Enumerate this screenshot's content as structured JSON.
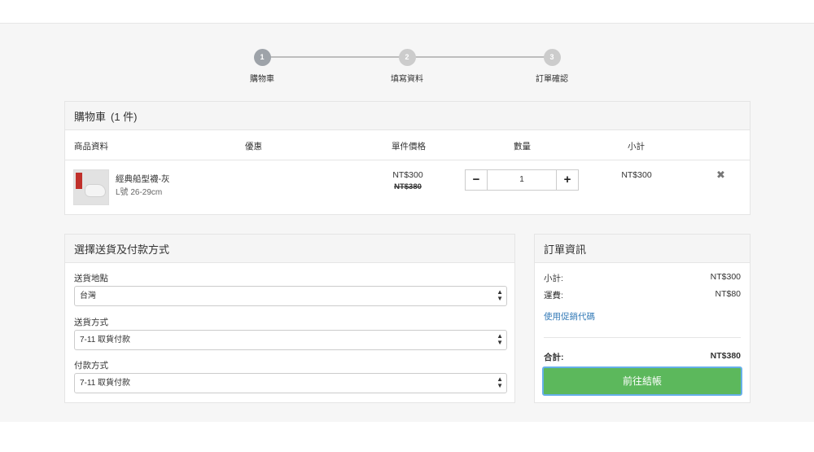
{
  "steps": [
    {
      "number": "1",
      "label": "購物車"
    },
    {
      "number": "2",
      "label": "填寫資料"
    },
    {
      "number": "3",
      "label": "訂單確認"
    }
  ],
  "cart": {
    "title": "購物車",
    "count_label": "(1 件)",
    "columns": [
      "商品資料",
      "優惠",
      "單件價格",
      "數量",
      "小計"
    ],
    "item": {
      "name": "經典船型襪-灰",
      "variant": "L號 26-29cm",
      "price": "NT$300",
      "original_price": "NT$380",
      "quantity": "1",
      "subtotal": "NT$300",
      "remove_icon": "✖"
    }
  },
  "shipping": {
    "title": "選擇送貨及付款方式",
    "fields": [
      {
        "label": "送貨地點",
        "value": "台灣"
      },
      {
        "label": "送貨方式",
        "value": "7-11 取貨付款"
      },
      {
        "label": "付款方式",
        "value": "7-11 取貨付款"
      }
    ]
  },
  "order": {
    "title": "訂單資訊",
    "subtotal_label": "小計:",
    "subtotal_value": "NT$300",
    "shipping_label": "運費:",
    "shipping_value": "NT$80",
    "promo_link": "使用促銷代碼",
    "total_label": "合計:",
    "total_value": "NT$380",
    "checkout_button": "前往結帳"
  },
  "colors": {
    "checkout": "#5cb85c",
    "link": "#337ab7",
    "step_active": "#9ea3a9",
    "step_inactive": "#cccccc"
  }
}
